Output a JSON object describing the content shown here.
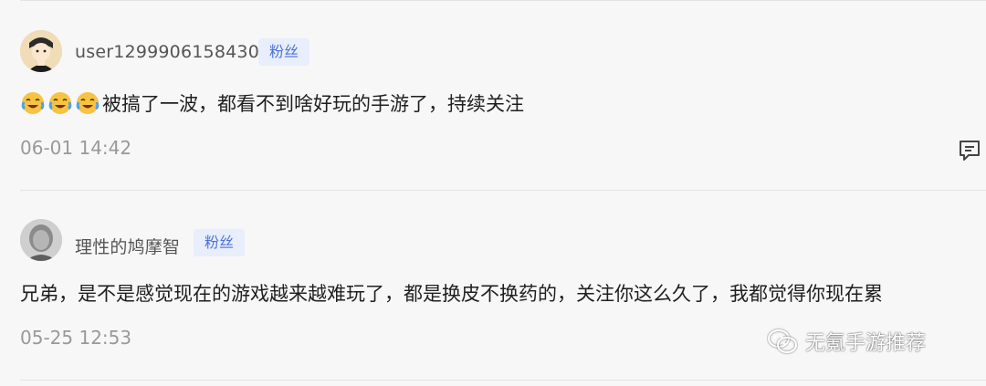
{
  "comments": [
    {
      "username": "user1299906158430",
      "badge": "粉丝",
      "emojis": [
        "laughing-crying-emoji",
        "laughing-crying-emoji",
        "laughing-crying-emoji"
      ],
      "text": "被搞了一波，都看不到啥好玩的手游了，持续关注",
      "timestamp": "06-01 14:42",
      "reply_icon": "comment-icon"
    },
    {
      "username": "理性的鸠摩智",
      "badge": "粉丝",
      "text": "兄弟，是不是感觉现在的游戏越来越难玩了，都是换皮不换药的，关注你这么久了，我都觉得你现在累",
      "timestamp": "05-25 12:53"
    }
  ],
  "watermark": {
    "text": "无氪手游推荐",
    "icon": "wechat-icon"
  },
  "colors": {
    "badge_bg": "#e8eefc",
    "badge_text": "#4b74d6",
    "timestamp": "#999999"
  }
}
